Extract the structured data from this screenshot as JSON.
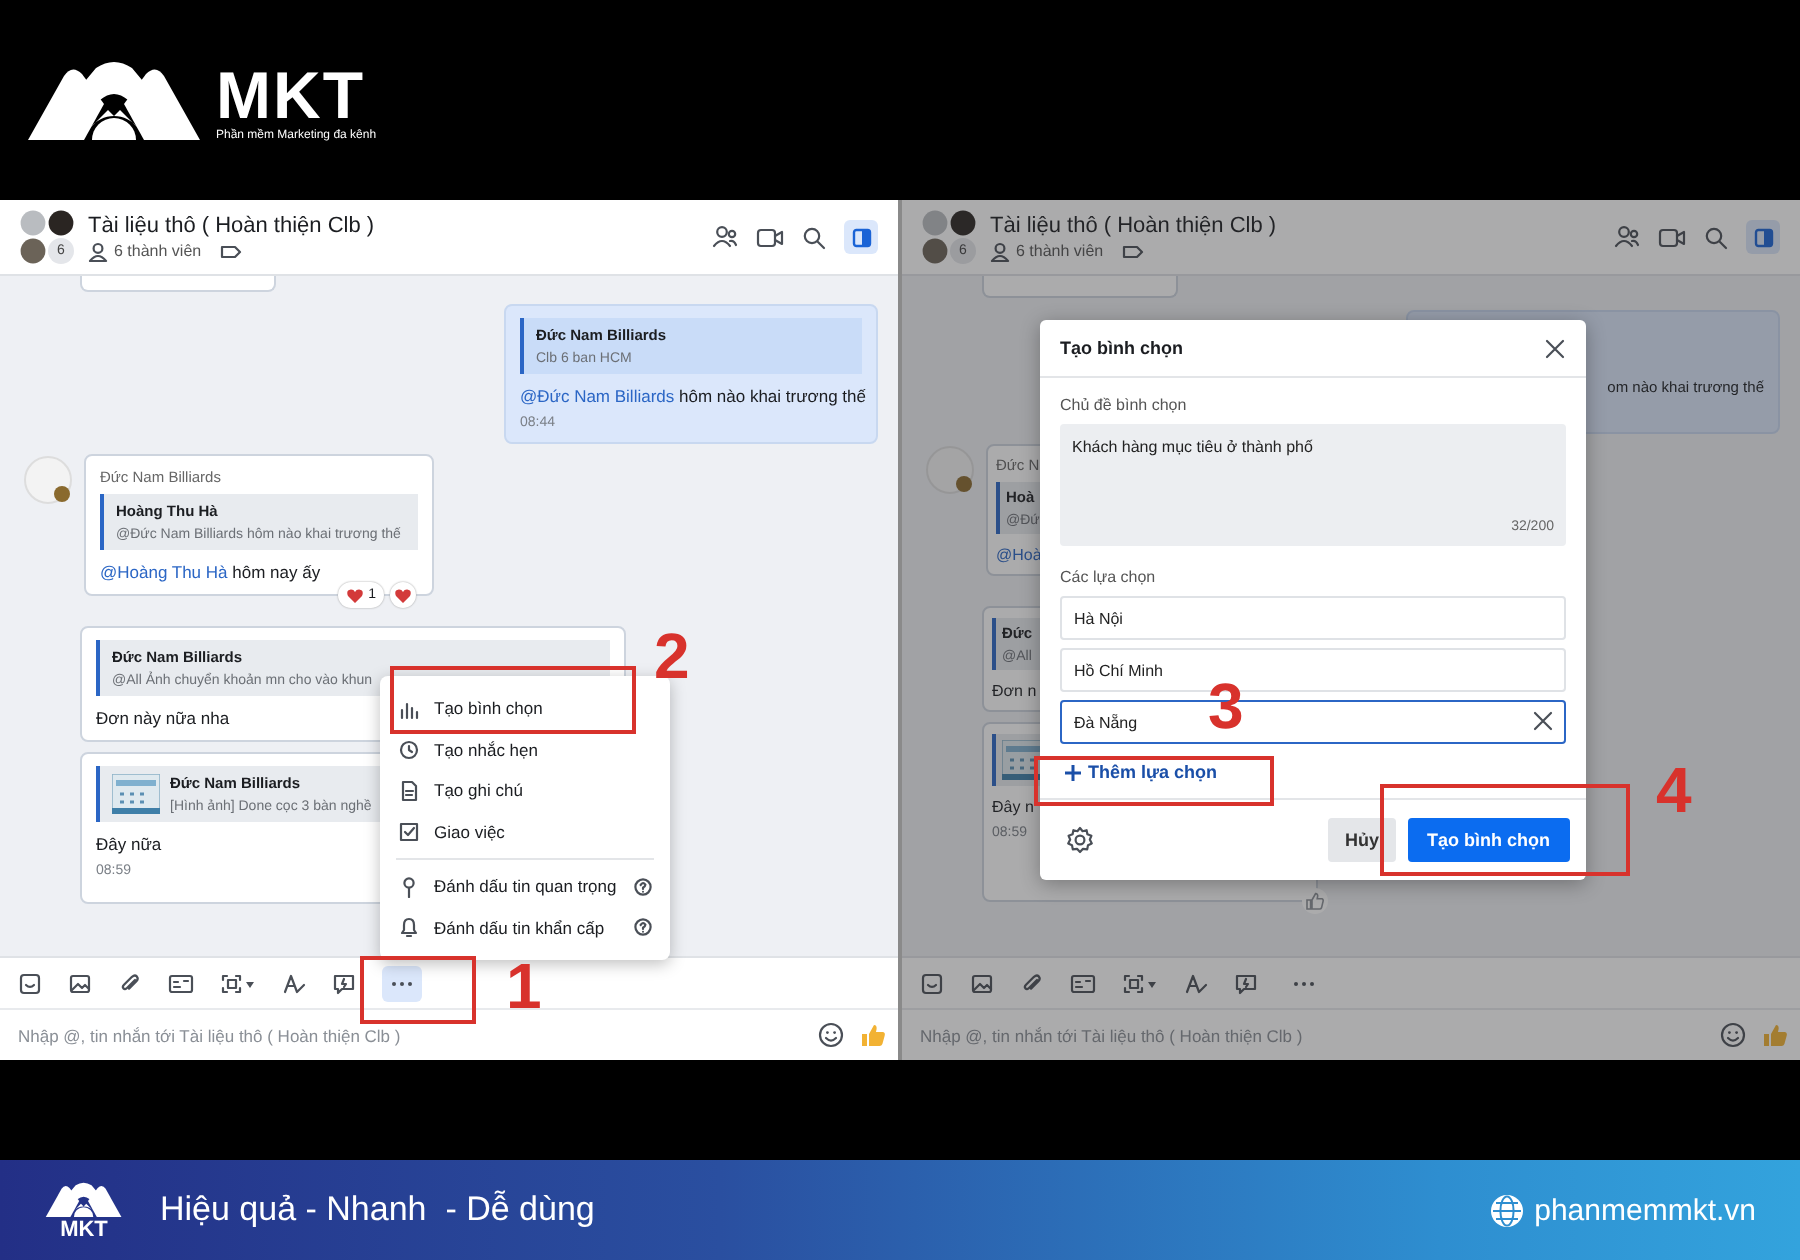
{
  "brand": {
    "name": "MKT",
    "tagline": "Phần mềm Marketing đa kênh"
  },
  "panels": [
    {
      "dimmed": false,
      "title": "Tài liệu thô ( Hoàn thiện Clb )",
      "avatar_count": "6",
      "members": "6 thành viên",
      "toolbar_more_active": true,
      "input_placeholder": "Nhập @, tin nhắn tới Tài liệu thô ( Hoàn thiện Clb )",
      "messages": [
        {
          "kind": "stub"
        },
        {
          "kind": "outgoing",
          "quote": {
            "title": "Đức Nam Billiards",
            "text": "Clb 6 ban HCM"
          },
          "mention": "@Đức Nam Billiards",
          "text": "hôm nào khai trương thế",
          "time": "08:44"
        },
        {
          "kind": "incoming",
          "avatar": true,
          "sender": "Đức Nam Billiards",
          "quote": {
            "title": "Hoàng Thu Hà",
            "text": "@Đức Nam Billiards hôm nào khai trương thế"
          },
          "mention": "@Hoàng Thu Hà",
          "text": "hôm nay ấy",
          "reaction_count": "1"
        },
        {
          "kind": "incoming",
          "quote": {
            "title": "Đức Nam Billiards",
            "text": "@All Ảnh chuyển khoản mn cho vào khun"
          },
          "text": "Đơn này nữa nha"
        },
        {
          "kind": "incoming",
          "quote": {
            "thumbnail": true,
            "title": "Đức Nam Billiards",
            "text": "[Hình ảnh] Done cọc 3 bàn nghề"
          },
          "text": "Đây nữa",
          "time": "08:59"
        }
      ],
      "menu": {
        "groups": [
          {
            "items": [
              {
                "label": "Tạo bình chọn",
                "help": false
              },
              {
                "label": "Tạo nhắc hẹn",
                "help": false
              },
              {
                "label": "Tạo ghi chú",
                "help": false
              },
              {
                "label": "Giao việc",
                "help": false
              }
            ]
          },
          {
            "items": [
              {
                "label": "Đánh dấu tin quan trọng",
                "help": true
              },
              {
                "label": "Đánh dấu tin khẩn cấp",
                "help": true
              }
            ]
          }
        ]
      }
    },
    {
      "dimmed": true,
      "title": "Tài liệu thô ( Hoàn thiện Clb )",
      "avatar_count": "6",
      "members": "6 thành viên",
      "toolbar_more_active": false,
      "input_placeholder": "Nhập @, tin nhắn tới Tài liệu thô ( Hoàn thiện Clb )",
      "messages": [
        {
          "kind": "stub"
        },
        {
          "kind": "outgoing",
          "text": "om nào khai trương thế"
        },
        {
          "kind": "incoming",
          "avatar": true,
          "sender": "Đức N",
          "quote": {
            "title": "Hoà",
            "text": "@Đứ"
          },
          "mention": "@Hoà"
        },
        {
          "kind": "incoming",
          "quote": {
            "title": "Đức",
            "text": "@All"
          },
          "text": "Đơn n"
        },
        {
          "kind": "incoming",
          "quote": {
            "thumbnail": true
          },
          "text": "Đây n",
          "time": "08:59",
          "liked": true
        }
      ],
      "dialog": {
        "title": "Tạo bình chọn",
        "topic_label": "Chủ đề bình chọn",
        "topic": "Khách hàng mục tiêu ở thành phố",
        "counter": "32/200",
        "options_label": "Các lựa chọn",
        "options": [
          {
            "value": "Hà Nội",
            "focused": false
          },
          {
            "value": "Hồ Chí Minh",
            "focused": false
          },
          {
            "value": "Đà Nẵng",
            "focused": true
          }
        ],
        "add_option": "Thêm lựa chọn",
        "cancel": "Hủy",
        "submit": "Tạo bình chọn"
      }
    }
  ],
  "annotations": [
    {
      "label": "1"
    },
    {
      "label": "2"
    },
    {
      "label": "3"
    },
    {
      "label": "4"
    }
  ],
  "banner": {
    "logo": "MKT",
    "slogan": "Hiệu quả - Nhanh  - Dễ dùng",
    "website": "phanmemmkt.vn"
  }
}
